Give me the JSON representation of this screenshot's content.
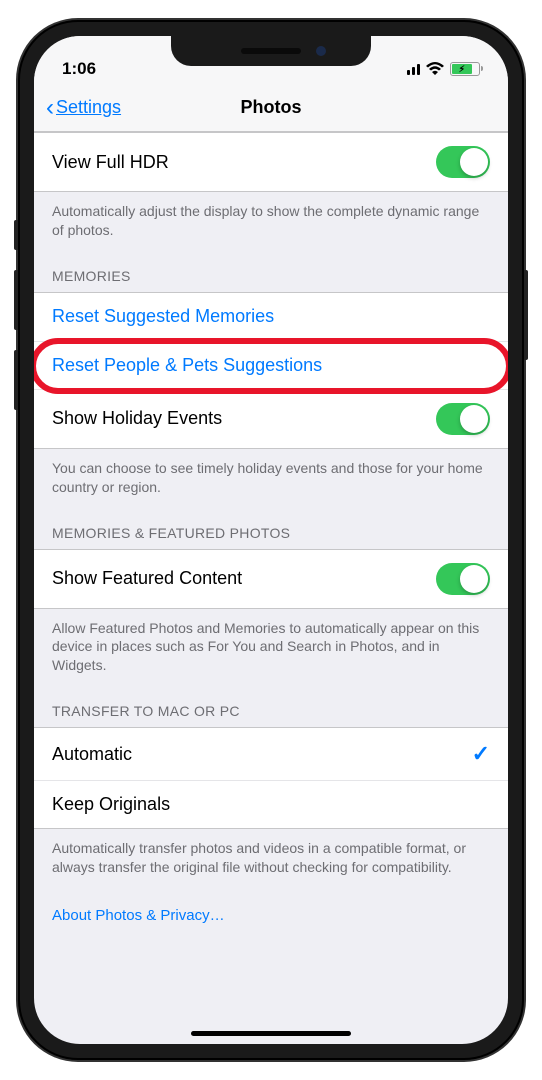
{
  "status": {
    "time": "1:06"
  },
  "nav": {
    "back_label": "Settings",
    "title": "Photos"
  },
  "hdr": {
    "view_full_hdr": "View Full HDR",
    "switch_on": true,
    "footer": "Automatically adjust the display to show the complete dynamic range of photos."
  },
  "memories": {
    "header": "MEMORIES",
    "reset_suggested": "Reset Suggested Memories",
    "reset_people": "Reset People & Pets Suggestions",
    "show_holiday": "Show Holiday Events",
    "holiday_on": true,
    "footer": "You can choose to see timely holiday events and those for your home country or region."
  },
  "featured": {
    "header": "MEMORIES & FEATURED PHOTOS",
    "show_featured": "Show Featured Content",
    "featured_on": true,
    "footer": "Allow Featured Photos and Memories to automatically appear on this device in places such as For You and Search in Photos, and in Widgets."
  },
  "transfer": {
    "header": "TRANSFER TO MAC OR PC",
    "automatic": "Automatic",
    "keep_originals": "Keep Originals",
    "selected": "automatic",
    "footer": "Automatically transfer photos and videos in a compatible format, or always transfer the original file without checking for compatibility."
  },
  "about_link": "About Photos & Privacy…"
}
